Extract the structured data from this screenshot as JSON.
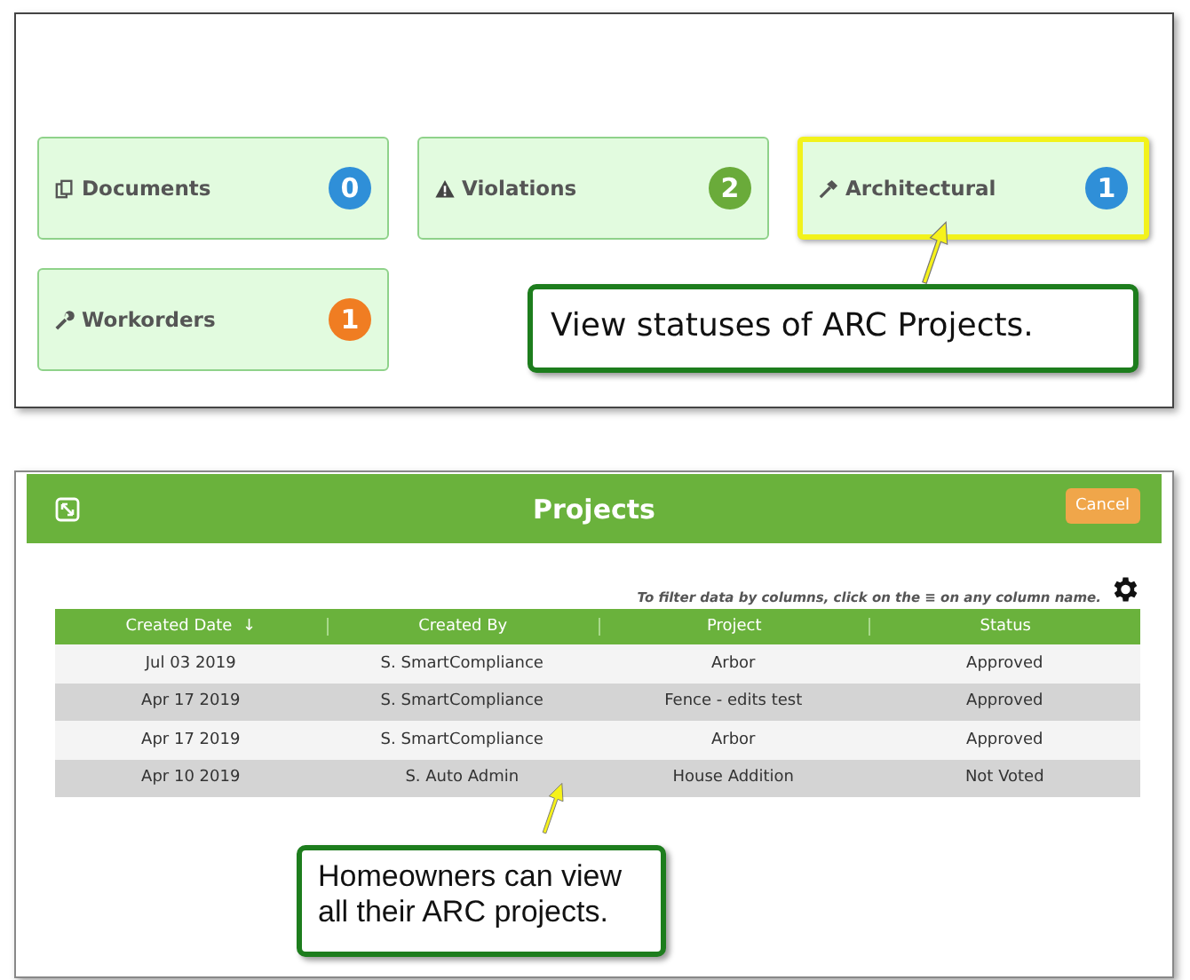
{
  "tiles": [
    {
      "label": "Documents",
      "kind": "documents",
      "count": "0",
      "color": "#2f8fd8",
      "highlighted": false
    },
    {
      "label": "Violations",
      "kind": "warning",
      "count": "2",
      "color": "#6aab3a",
      "highlighted": false
    },
    {
      "label": "Architectural",
      "kind": "hammer",
      "count": "1",
      "color": "#2f8fd8",
      "highlighted": true
    },
    {
      "label": "Workorders",
      "kind": "wrench",
      "count": "1",
      "color": "#f07d22",
      "highlighted": false
    }
  ],
  "callout_top": "View statuses of ARC Projects.",
  "dialog": {
    "title": "Projects",
    "cancel": "Cancel",
    "filter_hint": "To filter data by columns, click on the ≡ on any column name."
  },
  "table": {
    "columns": [
      {
        "label": "Created Date",
        "sort": "↓"
      },
      {
        "label": "Created By"
      },
      {
        "label": "Project"
      },
      {
        "label": "Status"
      }
    ],
    "rows": [
      [
        "Jul 03 2019",
        "S. SmartCompliance",
        "Arbor",
        "Approved"
      ],
      [
        "Apr 17 2019",
        "S. SmartCompliance",
        "Fence - edits test",
        "Approved"
      ],
      [
        "Apr 17 2019",
        "S. SmartCompliance",
        "Arbor",
        "Approved"
      ],
      [
        "Apr 10 2019",
        "S. Auto Admin",
        "House Addition",
        "Not Voted"
      ]
    ]
  },
  "callout_bottom": "Homeowners can view all their ARC projects."
}
